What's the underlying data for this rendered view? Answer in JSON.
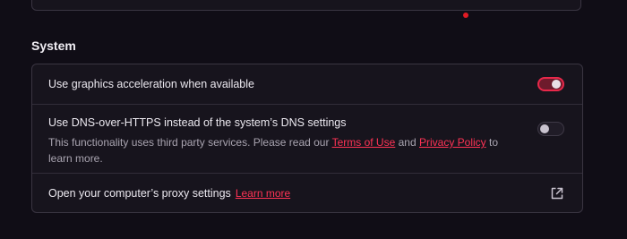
{
  "section": {
    "title": "System"
  },
  "settings": {
    "graphics_acceleration": {
      "label": "Use graphics acceleration when available",
      "enabled": true
    },
    "dns_over_https": {
      "label": "Use DNS-over-HTTPS instead of the system’s DNS settings",
      "desc_before": "This functionality uses third party services. Please read our ",
      "terms_link": "Terms of Use",
      "desc_and": " and ",
      "privacy_link": "Privacy Policy",
      "desc_after": " to learn more.",
      "enabled": false
    },
    "proxy": {
      "label": "Open your computer’s proxy settings",
      "learn_more": "Learn more",
      "icon": "external-link-icon"
    }
  },
  "colors": {
    "accent": "#ff3355",
    "notification_dot": "#e01b24",
    "background": "#100d16",
    "card": "#17141d"
  }
}
